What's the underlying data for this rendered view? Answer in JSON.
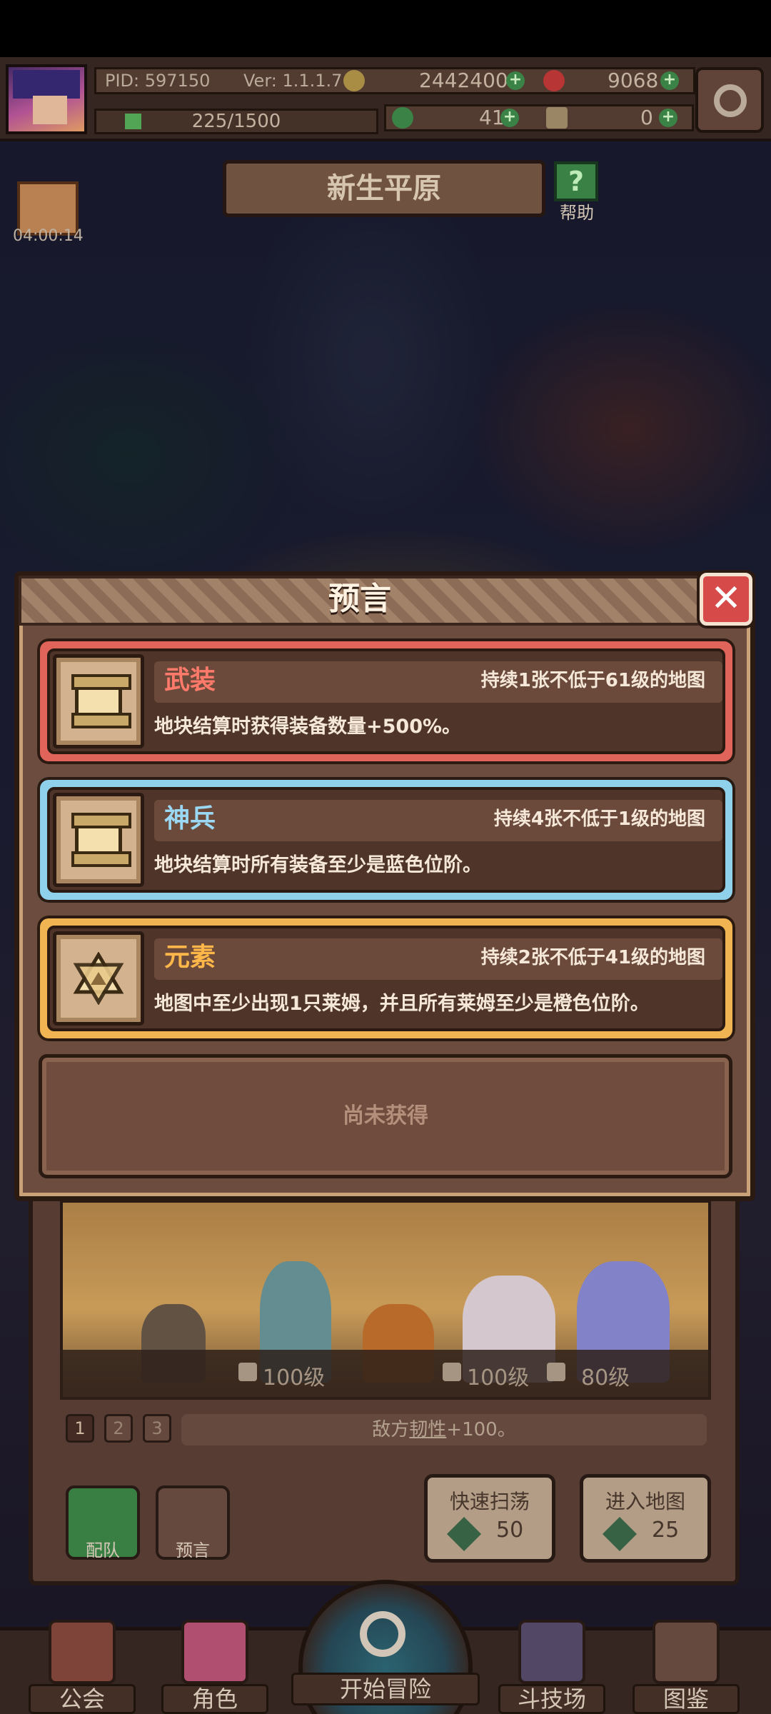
{
  "hud": {
    "pid": "PID: 597150",
    "version": "Ver: 1.1.1.7",
    "gold": "2442400",
    "gems": "9068",
    "exp": "225/1500",
    "clover": "41",
    "item": "0",
    "exp_progress": 0.15
  },
  "location": {
    "name": "新生平原",
    "help_label": "帮助",
    "gift_timer": "04:00:14"
  },
  "modal": {
    "title": "预言",
    "cards": [
      {
        "name": "武装",
        "condition": "持续1张不低于61级的地图",
        "description": "地块结算时获得装备数量+500%。",
        "border_color": "#e0645a",
        "name_color": "#ff7a6a",
        "icon": "scroll-icon"
      },
      {
        "name": "神兵",
        "condition": "持续4张不低于1级的地图",
        "description": "地块结算时所有装备至少是蓝色位阶。",
        "border_color": "#8fd0ea",
        "name_color": "#9ad8f4",
        "icon": "scroll-icon"
      },
      {
        "name": "元素",
        "condition": "持续2张不低于41级的地图",
        "description": "地图中至少出现1只莱姆，并且所有莱姆至少是橙色位阶。",
        "border_color": "#f0b552",
        "name_color": "#ffb74a",
        "icon": "hexagram-icon"
      }
    ],
    "empty_slot": "尚未获得"
  },
  "map_panel": {
    "stat1": "100级",
    "stat2": "100级",
    "stat3": "80级",
    "pages": [
      "1",
      "2",
      "3"
    ],
    "modifier_prefix": "敌方",
    "modifier_underlined": "韧性",
    "modifier_suffix": "+100。",
    "team_label": "配队",
    "prophecy_label": "预言",
    "sweep_label": "快速扫荡",
    "sweep_cost": "50",
    "enter_label": "进入地图",
    "enter_cost": "25"
  },
  "nav": {
    "guild": "公会",
    "character": "角色",
    "adventure": "开始冒险",
    "arena": "斗技场",
    "codex": "图鉴"
  }
}
